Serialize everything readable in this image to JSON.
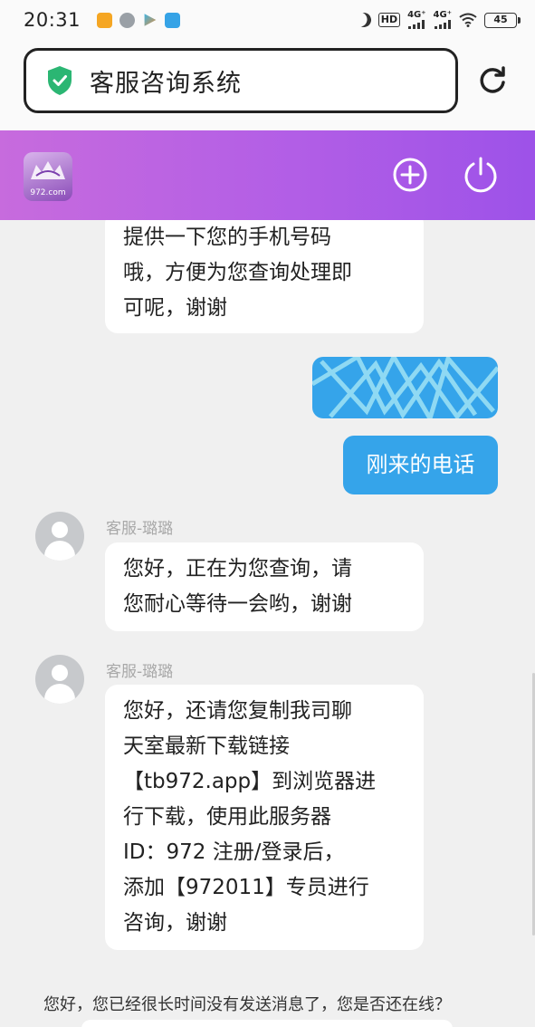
{
  "status_bar": {
    "time": "20:31",
    "hd_label": "HD",
    "network1": "4G⁺",
    "network2": "4G⁺",
    "battery": "45"
  },
  "browser": {
    "title": "客服咨询系统",
    "icons": {
      "secure": "shield-check-icon",
      "reload": "reload-icon"
    }
  },
  "header": {
    "logo_text": "972.com",
    "icons": {
      "add": "plus-circle-icon",
      "power": "power-icon"
    },
    "color_from": "#c76bdd",
    "color_to": "#9d52e8"
  },
  "messages": [
    {
      "type": "agent",
      "lines": [
        "提供一下您的手机号码",
        "哦，方便为您查询处理即",
        "可呢，谢谢"
      ]
    },
    {
      "type": "user",
      "text": "刚来的电话"
    },
    {
      "type": "agent",
      "sender": "客服-璐璐",
      "lines": [
        "您好，正在为您查询，请",
        "您耐心等待一会哟，谢谢"
      ]
    },
    {
      "type": "agent",
      "sender": "客服-璐璐",
      "lines": [
        "您好，还请您复制我司聊",
        "天室最新下载链接",
        "【tb972.app】到浏览器进",
        "行下载，使用此服务器",
        "ID：972   注册/登录后，",
        "添加【972011】专员进行",
        "咨询，谢谢"
      ]
    }
  ],
  "system_message": "您好，您已经很长时间没有发送消息了，您是否还在线？",
  "colors": {
    "user_bubble": "#35a4ea",
    "chat_bg": "#f0f0f0"
  }
}
